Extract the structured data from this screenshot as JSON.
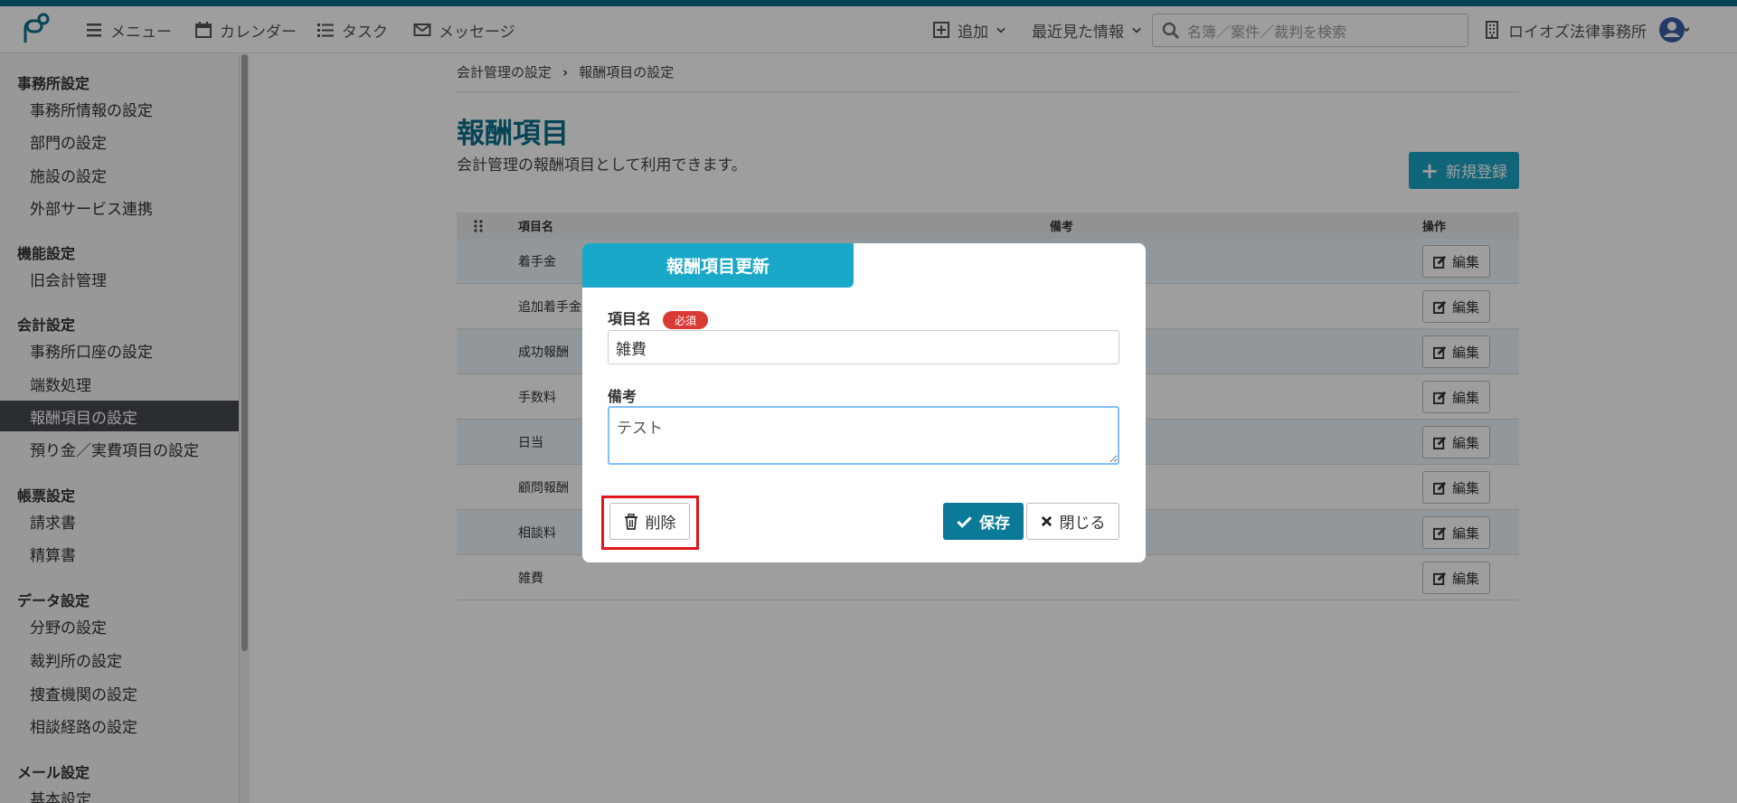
{
  "topbar": {
    "nav": [
      {
        "label": "メニュー",
        "icon": "menu-icon"
      },
      {
        "label": "カレンダー",
        "icon": "calendar-icon"
      },
      {
        "label": "タスク",
        "icon": "task-list-icon"
      },
      {
        "label": "メッセージ",
        "icon": "envelope-icon"
      }
    ],
    "add_label": "追加",
    "recent_label": "最近見た情報",
    "search_placeholder": "名簿／案件／裁判を検索",
    "office_name": "ロイオズ法律事務所",
    "accent_color": "#0a6e8c"
  },
  "sidebar": {
    "groups": [
      {
        "title": "事務所設定",
        "items": [
          "事務所情報の設定",
          "部門の設定",
          "施設の設定",
          "外部サービス連携"
        ]
      },
      {
        "title": "機能設定",
        "items": [
          "旧会計管理"
        ]
      },
      {
        "title": "会計設定",
        "items": [
          "事務所口座の設定",
          "端数処理",
          "報酬項目の設定",
          "預り金／実費項目の設定"
        ]
      },
      {
        "title": "帳票設定",
        "items": [
          "請求書",
          "精算書"
        ]
      },
      {
        "title": "データ設定",
        "items": [
          "分野の設定",
          "裁判所の設定",
          "捜査機関の設定",
          "相談経路の設定"
        ]
      },
      {
        "title": "メール設定",
        "items": [
          "基本設定"
        ]
      }
    ],
    "active_item": "報酬項目の設定"
  },
  "main": {
    "breadcrumb": [
      "会計管理の設定",
      "報酬項目の設定"
    ],
    "title": "報酬項目",
    "description": "会計管理の報酬項目として利用できます。",
    "new_button": "新規登録",
    "table": {
      "headers": [
        "項目名",
        "備考",
        "操作"
      ],
      "rows": [
        "着手金",
        "追加着手金",
        "成功報酬",
        "手数料",
        "日当",
        "顧問報酬",
        "相談料",
        "雑費"
      ],
      "edit_label": "編集"
    }
  },
  "modal": {
    "title": "報酬項目更新",
    "name_label": "項目名",
    "required_badge": "必須",
    "name_value": "雑費",
    "note_label": "備考",
    "note_value": "テスト",
    "delete_label": "削除",
    "save_label": "保存",
    "close_label": "閉じる"
  }
}
